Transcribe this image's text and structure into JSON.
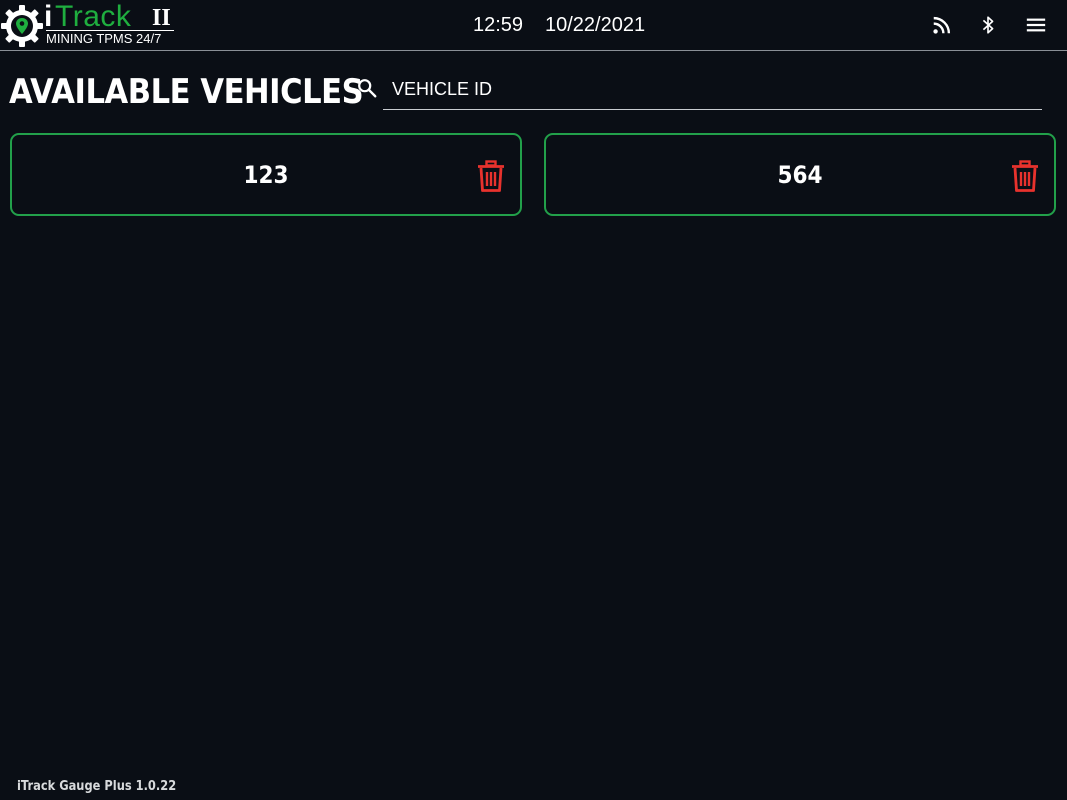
{
  "header": {
    "logo": {
      "i": "i",
      "track": "Track",
      "ii": "II",
      "tagline": "MINING TPMS 24/7"
    },
    "time": "12:59",
    "date": "10/22/2021",
    "icons": [
      "rss-icon",
      "bluetooth-icon",
      "menu-icon"
    ]
  },
  "page": {
    "title": "AVAILABLE VEHICLES"
  },
  "search": {
    "placeholder": "VEHICLE ID",
    "value": ""
  },
  "vehicles": [
    {
      "id": "123"
    },
    {
      "id": "564"
    }
  ],
  "footer": {
    "version": "iTrack Gauge Plus 1.0.22"
  },
  "colors": {
    "background": "#0a0e15",
    "brand_green": "#1fae3f",
    "card_border": "#22a04a",
    "delete_red": "#e8322d"
  }
}
